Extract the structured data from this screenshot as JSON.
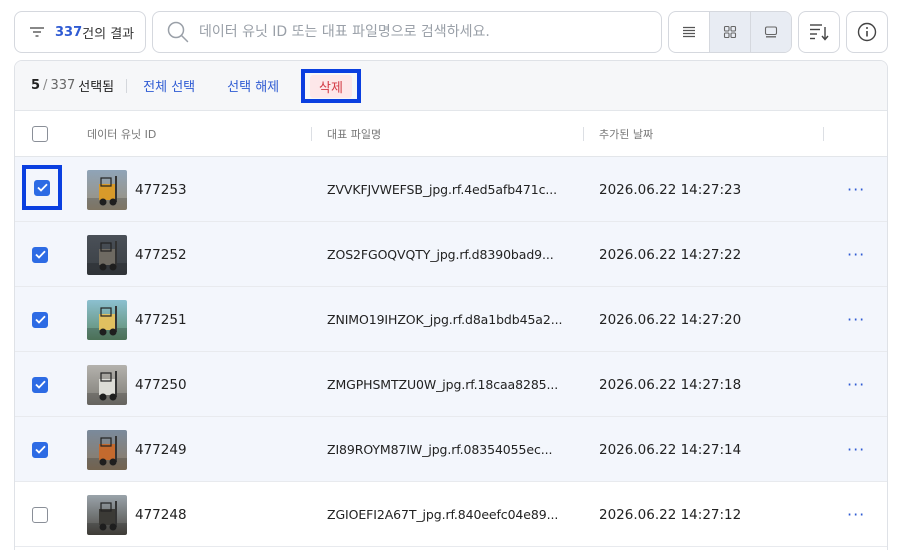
{
  "toolbar": {
    "results_count": "337",
    "results_suffix": "건의 결과",
    "search_placeholder": "데이터 유닛 ID 또는 대표 파일명으로 검색하세요.",
    "search_value": ""
  },
  "selection": {
    "selected": "5",
    "slash": "/",
    "total": "337",
    "suffix": "선택됨",
    "select_all": "전체 선택",
    "deselect": "선택 해제",
    "delete": "삭제"
  },
  "columns": {
    "id": "데이터 유닛 ID",
    "filename": "대표 파일명",
    "date": "추가된 날짜"
  },
  "more_glyph": "···",
  "rows": [
    {
      "id": "477253",
      "filename": "ZVVKFJVWEFSB_jpg.rf.4ed5afb471c...",
      "date": "2026.06.22 14:27:23",
      "checked": true
    },
    {
      "id": "477252",
      "filename": "ZOS2FGOQVQTY_jpg.rf.d8390bad9...",
      "date": "2026.06.22 14:27:22",
      "checked": true
    },
    {
      "id": "477251",
      "filename": "ZNIMO19IHZOK_jpg.rf.d8a1bdb45a2...",
      "date": "2026.06.22 14:27:20",
      "checked": true
    },
    {
      "id": "477250",
      "filename": "ZMGPHSMTZU0W_jpg.rf.18caa8285...",
      "date": "2026.06.22 14:27:18",
      "checked": true
    },
    {
      "id": "477249",
      "filename": "ZI89ROYM87IW_jpg.rf.08354055ec...",
      "date": "2026.06.22 14:27:14",
      "checked": true
    },
    {
      "id": "477248",
      "filename": "ZGIOEFI2A67T_jpg.rf.840eefc04e89...",
      "date": "2026.06.22 14:27:12",
      "checked": false
    }
  ],
  "icons": {
    "filter": "filter-icon",
    "search": "search-icon",
    "list": "list-view-icon",
    "grid": "grid-view-icon",
    "gallery": "gallery-view-icon",
    "sort": "sort-icon",
    "info": "info-icon"
  },
  "colors": {
    "accent": "#2f5bd3",
    "checkbox": "#2d6be4",
    "highlight": "#0a3fe0",
    "danger": "#d33a45",
    "danger_bg": "#fde7e9"
  }
}
